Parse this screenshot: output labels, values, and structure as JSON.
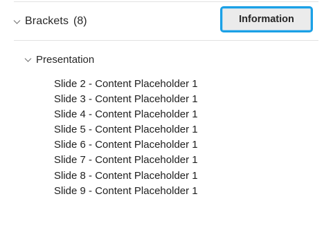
{
  "section": {
    "title": "Brackets",
    "count": "(8)",
    "expand_icon": "chevron-down-icon"
  },
  "info_button": {
    "label": "Information",
    "accent_color": "#1aa0e6"
  },
  "group": {
    "title": "Presentation",
    "expand_icon": "chevron-down-icon"
  },
  "items": [
    {
      "label": "Slide 2 - Content Placeholder 1"
    },
    {
      "label": "Slide 3 - Content Placeholder 1"
    },
    {
      "label": "Slide 4 - Content Placeholder 1"
    },
    {
      "label": "Slide 5 - Content Placeholder 1"
    },
    {
      "label": "Slide 6 - Content Placeholder 1"
    },
    {
      "label": "Slide 7 - Content Placeholder 1"
    },
    {
      "label": "Slide 8 - Content Placeholder 1"
    },
    {
      "label": "Slide 9 - Content Placeholder 1"
    }
  ]
}
